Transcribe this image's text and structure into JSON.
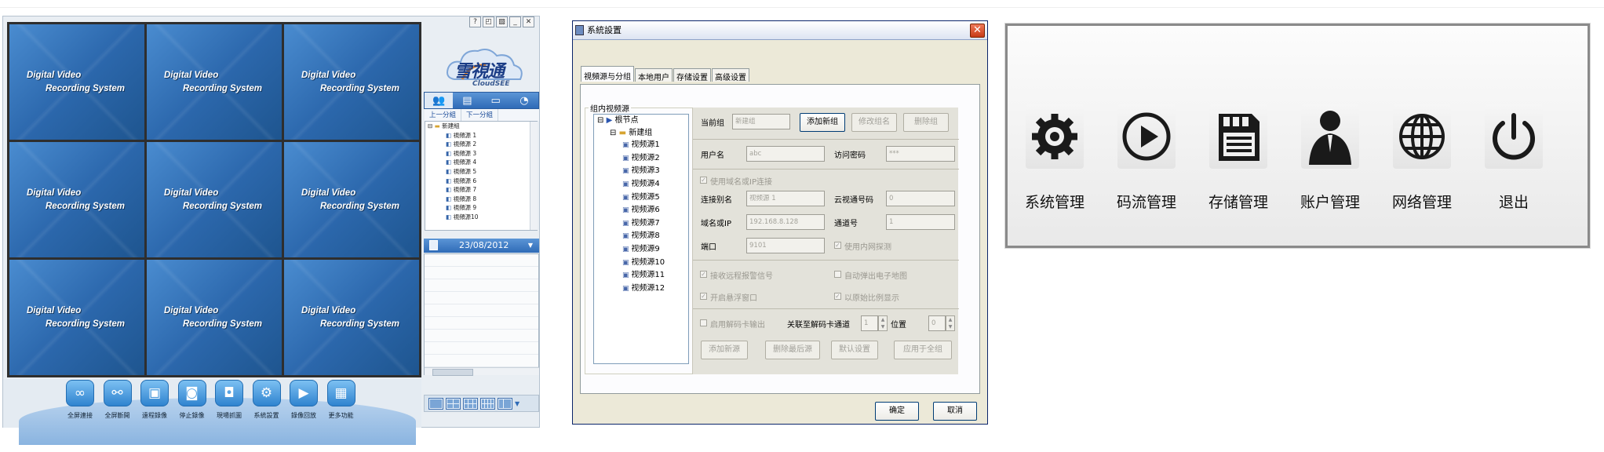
{
  "panel_a": {
    "window_buttons": [
      "?",
      "◰",
      "▧",
      "_",
      "✕"
    ],
    "video_cell_line1": "Digital Video",
    "video_cell_line2": "Recording System",
    "logo_text": "雪視通",
    "logo_sub": "CloudSEE",
    "group_prev": "上一分組",
    "group_next": "下一分組",
    "tree_root": "新建組",
    "tree_children": [
      "視頻源 1",
      "視頻源 2",
      "視頻源 3",
      "視頻源 4",
      "視頻源 5",
      "視頻源 6",
      "視頻源 7",
      "視頻源 8",
      "視頻源 9",
      "視頻源10"
    ],
    "date": "23/08/2012",
    "toolbar": [
      {
        "icon": "link-icon",
        "label": "全屏連接"
      },
      {
        "icon": "unlink-icon",
        "label": "全屏斷開"
      },
      {
        "icon": "record-icon",
        "label": "遠程錄像"
      },
      {
        "icon": "stop-record-icon",
        "label": "停止錄像"
      },
      {
        "icon": "snapshot-icon",
        "label": "現場抓圖"
      },
      {
        "icon": "settings-icon",
        "label": "系統設置"
      },
      {
        "icon": "playback-icon",
        "label": "錄像回放"
      },
      {
        "icon": "more-icon",
        "label": "更多功能"
      }
    ]
  },
  "panel_b": {
    "title": "系統設置",
    "tabs": [
      "視頻源与分组",
      "本地用户",
      "存储设置",
      "高级设置"
    ],
    "group_label": "组内视频源",
    "tree_root": "根节点",
    "tree_group": "新建组",
    "tree_children": [
      "视频源1",
      "视频源2",
      "视频源3",
      "视频源4",
      "视频源5",
      "视频源6",
      "视频源7",
      "视频源8",
      "视频源9",
      "视频源10",
      "视频源11",
      "视频源12"
    ],
    "current_group_label": "当前组",
    "current_group_value": "新建组",
    "add_group_btn": "添加新组",
    "rename_group_btn": "修改组名",
    "delete_group_btn": "删除组",
    "username_label": "用户名",
    "username_value": "abc",
    "password_label": "访问密码",
    "password_value": "***",
    "use_domain_label": "使用域名或IP连接",
    "conn_alias_label": "连接别名",
    "conn_alias_value": "视频源 1",
    "cloud_id_label": "云视通号码",
    "cloud_id_value": "0",
    "domain_label": "域名或IP",
    "domain_value": "192.168.8.128",
    "channel_label": "通道号",
    "channel_value": "1",
    "port_label": "端口",
    "port_value": "9101",
    "lan_probe_label": "使用内网探测",
    "alarm_label": "接收远程报警信号",
    "popup_map_label": "自动弹出电子地图",
    "hover_window_label": "开启悬浮窗口",
    "ratio_label": "以原始比例显示",
    "decoder_label": "启用解码卡输出",
    "decoder_channel_label": "关联至解码卡通道",
    "decoder_channel_value": "1",
    "position_label": "位置",
    "position_value": "0",
    "add_source_btn": "添加新源",
    "delete_last_btn": "删除最后源",
    "default_btn": "默认设置",
    "apply_all_btn": "应用于全组",
    "ok_btn": "确定",
    "cancel_btn": "取消"
  },
  "panel_c": {
    "items": [
      {
        "icon": "gear-icon",
        "label": "系统管理"
      },
      {
        "icon": "play-icon",
        "label": "码流管理"
      },
      {
        "icon": "sd-card-icon",
        "label": "存储管理"
      },
      {
        "icon": "user-icon",
        "label": "账户管理"
      },
      {
        "icon": "globe-icon",
        "label": "网络管理"
      },
      {
        "icon": "power-icon",
        "label": "退出"
      }
    ]
  },
  "colors": {
    "accent_blue": "#2f6bb7",
    "video_blue": "#2c68ad",
    "xp_border": "#0a246a"
  }
}
